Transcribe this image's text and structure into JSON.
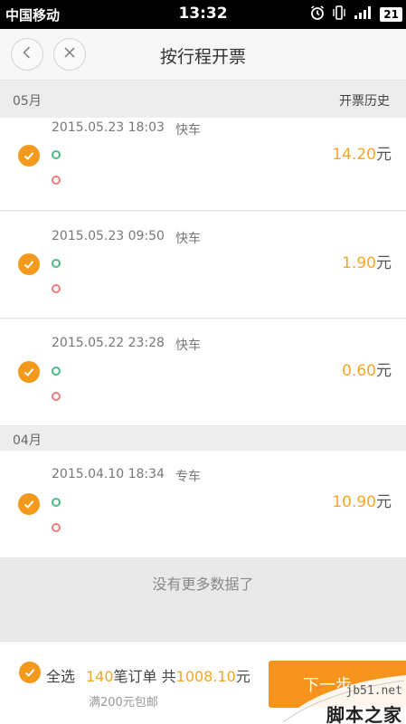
{
  "status_bar": {
    "carrier": "中国移动",
    "time": "13:32",
    "battery": "21",
    "icons": [
      "alarm-icon",
      "vibrate-icon",
      "signal-icon",
      "battery-icon"
    ]
  },
  "header": {
    "title": "按行程开票",
    "back_icon": "chevron-left-icon",
    "close_icon": "close-icon"
  },
  "sections": [
    {
      "month": "05月",
      "history_label": "开票历史",
      "trips": [
        {
          "datetime": "2015.05.23 18:03",
          "type": "快车",
          "amount": "14.20",
          "unit": "元",
          "checked": true
        },
        {
          "datetime": "2015.05.23 09:50",
          "type": "快车",
          "amount": "1.90",
          "unit": "元",
          "checked": true
        },
        {
          "datetime": "2015.05.22 23:28",
          "type": "快车",
          "amount": "0.60",
          "unit": "元",
          "checked": true
        }
      ]
    },
    {
      "month": "04月",
      "trips": [
        {
          "datetime": "2015.04.10 18:34",
          "type": "专车",
          "amount": "10.90",
          "unit": "元",
          "checked": true
        }
      ]
    }
  ],
  "no_more_text": "没有更多数据了",
  "footer": {
    "select_all_label": "全选",
    "order_count": "140",
    "order_suffix": "笔订单 共",
    "total": "1008.10",
    "total_unit": "元",
    "free_shipping": "满200元包邮",
    "next_button_label": "下一步"
  },
  "watermark": {
    "site": "jb51.net",
    "brand": "脚本之家"
  },
  "colors": {
    "accent": "#f39a1c",
    "amount": "#f5a623",
    "start_dot": "#4cb98a",
    "end_dot": "#ee7b7b"
  }
}
